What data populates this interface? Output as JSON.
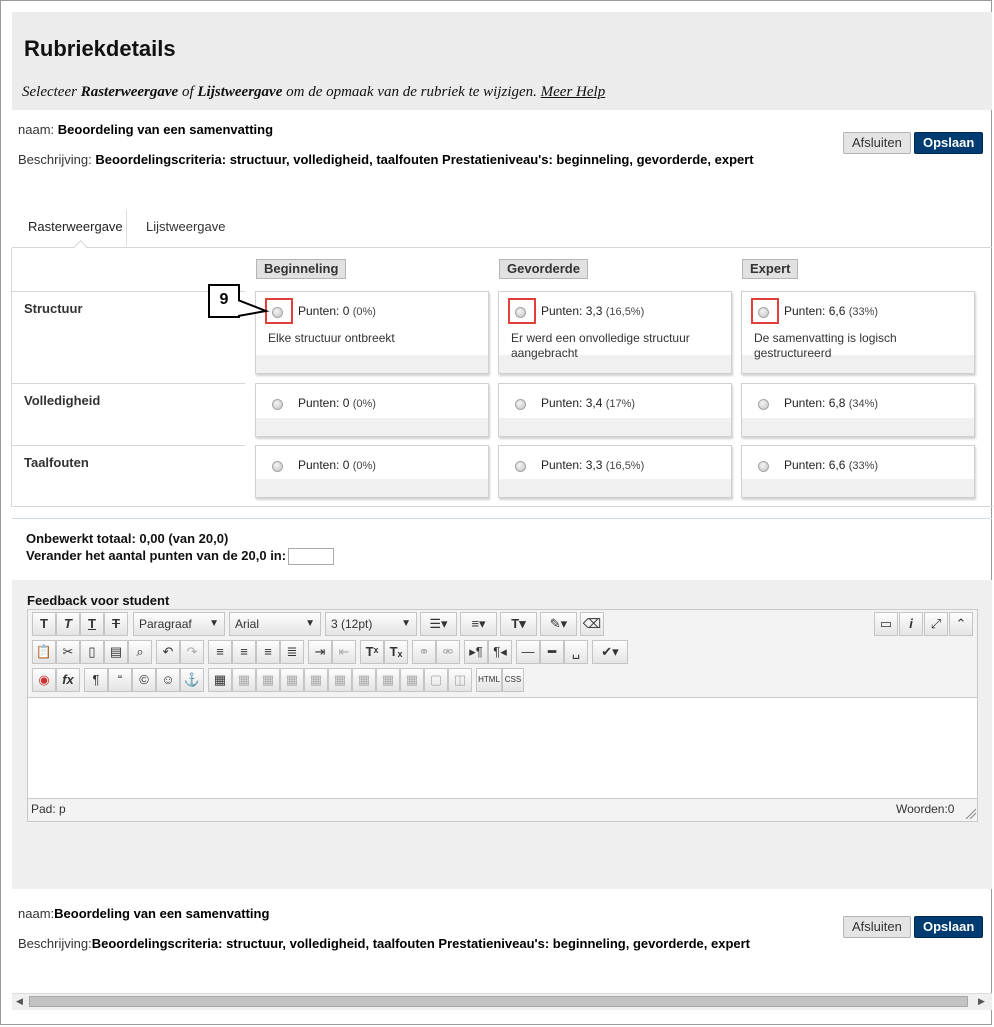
{
  "header": {
    "title": "Rubriekdetails",
    "instruction_pre": "Selecteer ",
    "instruction_b1": "Rasterweergave",
    "instruction_mid": " of ",
    "instruction_b2": "Lijstweergave",
    "instruction_post": " om de opmaak van de rubriek te wijzigen. ",
    "help_link": "Meer Help"
  },
  "details": {
    "name_label": "naam:",
    "name_value": "Beoordeling van een samenvatting",
    "desc_label": "Beschrijving:",
    "desc_value": "Beoordelingscriteria: structuur, volledigheid, taalfouten Prestatieniveau's: beginneling, gevorderde, expert"
  },
  "buttons": {
    "close": "Afsluiten",
    "save": "Opslaan"
  },
  "tabs": [
    "Rasterweergave",
    "Lijstweergave"
  ],
  "rubric": {
    "levels": [
      "Beginneling",
      "Gevorderde",
      "Expert"
    ],
    "rows": [
      {
        "label": "Structuur",
        "cells": [
          {
            "points": "Punten: 0",
            "pct": "(0%)",
            "desc": "Elke structuur ontbreekt"
          },
          {
            "points": "Punten: 3,3",
            "pct": "(16,5%)",
            "desc": "Er werd een onvolledige structuur aangebracht"
          },
          {
            "points": "Punten: 6,6",
            "pct": "(33%)",
            "desc": "De samenvatting is logisch gestructureerd"
          }
        ]
      },
      {
        "label": "Volledigheid",
        "cells": [
          {
            "points": "Punten: 0",
            "pct": "(0%)"
          },
          {
            "points": "Punten: 3,4",
            "pct": "(17%)"
          },
          {
            "points": "Punten: 6,8",
            "pct": "(34%)"
          }
        ]
      },
      {
        "label": "Taalfouten",
        "cells": [
          {
            "points": "Punten: 0",
            "pct": "(0%)"
          },
          {
            "points": "Punten: 3,3",
            "pct": "(16,5%)"
          },
          {
            "points": "Punten: 6,6",
            "pct": "(33%)"
          }
        ]
      }
    ]
  },
  "callout": "9",
  "totals": {
    "raw_total": "Onbewerkt totaal: 0,00 (van 20,0)",
    "change_points": "Verander het aantal punten van de 20,0 in:",
    "input_value": ""
  },
  "feedback": {
    "title": "Feedback voor student",
    "format_select": "Paragraaf",
    "font_select": "Arial",
    "size_select": "3 (12pt)",
    "path": "Pad: p",
    "words": "Woorden:0",
    "html_btn": "HTML",
    "css_btn": "CSS"
  },
  "footer": {
    "name_label": "naam:",
    "name_value": "Beoordeling van een samenvatting",
    "desc_label": "Beschrijving:",
    "desc_value": "Beoordelingscriteria: structuur, volledigheid, taalfouten Prestatieniveau's: beginneling, gevorderde, expert"
  },
  "colors": {
    "accent": "#003b72",
    "highlight": "#e0403a"
  }
}
